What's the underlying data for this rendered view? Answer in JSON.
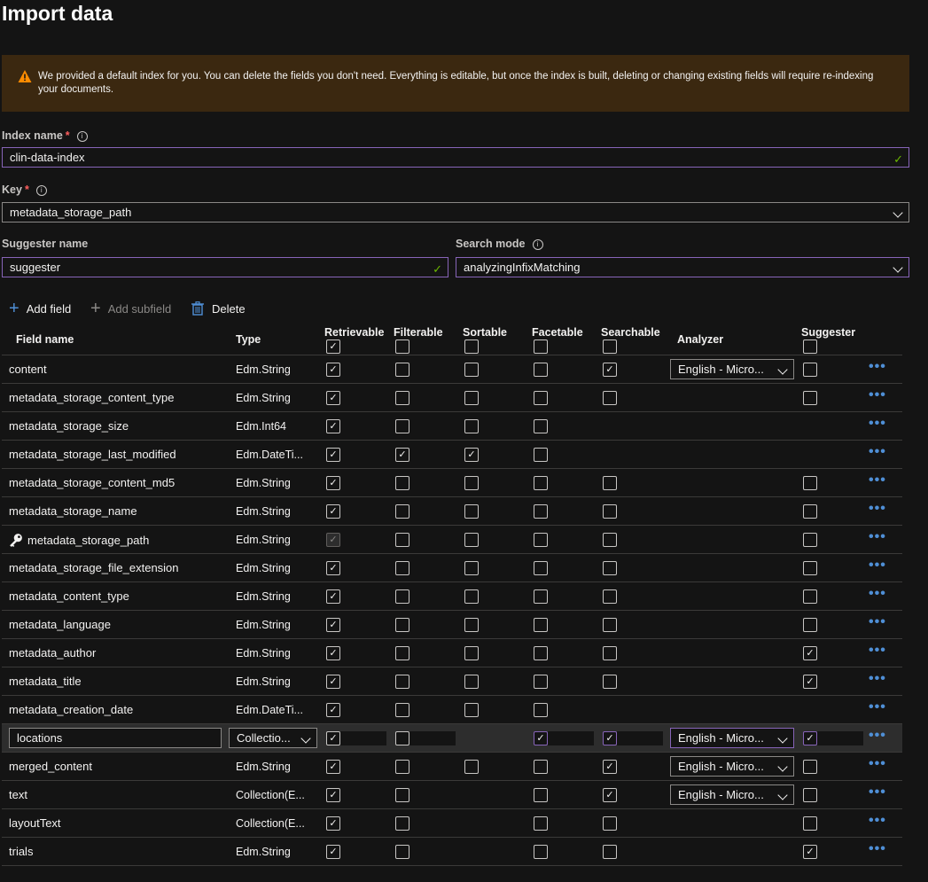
{
  "page_title": "Import data",
  "banner": {
    "message": "We provided a default index for you. You can delete the fields you don't need. Everything is editable, but once the index is built, deleting or changing existing fields will require re-indexing your documents."
  },
  "index_name": {
    "label": "Index name",
    "required_mark": "*",
    "value": "clin-data-index"
  },
  "key": {
    "label": "Key",
    "required_mark": "*",
    "value": "metadata_storage_path"
  },
  "suggester_name": {
    "label": "Suggester name",
    "value": "suggester"
  },
  "search_mode": {
    "label": "Search mode",
    "value": "analyzingInfixMatching"
  },
  "toolbar": {
    "add_field": "Add field",
    "add_subfield": "Add subfield",
    "delete": "Delete"
  },
  "columns": {
    "field_name": "Field name",
    "type": "Type",
    "retrievable": "Retrievable",
    "filterable": "Filterable",
    "sortable": "Sortable",
    "facetable": "Facetable",
    "searchable": "Searchable",
    "analyzer": "Analyzer",
    "suggester": "Suggester"
  },
  "header_checks": {
    "retrievable": true,
    "filterable": false,
    "sortable": false,
    "facetable": false,
    "searchable": false,
    "suggester": false
  },
  "fields": [
    {
      "name": "content",
      "type": "Edm.String",
      "retrievable": true,
      "filterable": false,
      "sortable": false,
      "facetable": false,
      "searchable": true,
      "analyzer": "English - Micro...",
      "suggester": false
    },
    {
      "name": "metadata_storage_content_type",
      "type": "Edm.String",
      "retrievable": true,
      "filterable": false,
      "sortable": false,
      "facetable": false,
      "searchable": false,
      "analyzer": null,
      "suggester": false
    },
    {
      "name": "metadata_storage_size",
      "type": "Edm.Int64",
      "retrievable": true,
      "filterable": false,
      "sortable": false,
      "facetable": false,
      "searchable": null,
      "analyzer": null,
      "suggester": null
    },
    {
      "name": "metadata_storage_last_modified",
      "type": "Edm.DateTi...",
      "retrievable": true,
      "filterable": true,
      "sortable": true,
      "facetable": false,
      "searchable": null,
      "analyzer": null,
      "suggester": null
    },
    {
      "name": "metadata_storage_content_md5",
      "type": "Edm.String",
      "retrievable": true,
      "filterable": false,
      "sortable": false,
      "facetable": false,
      "searchable": false,
      "analyzer": null,
      "suggester": false
    },
    {
      "name": "metadata_storage_name",
      "type": "Edm.String",
      "retrievable": true,
      "filterable": false,
      "sortable": false,
      "facetable": false,
      "searchable": false,
      "analyzer": null,
      "suggester": false
    },
    {
      "name": "metadata_storage_path",
      "type": "Edm.String",
      "retrievable": "disabled",
      "filterable": false,
      "sortable": false,
      "facetable": false,
      "searchable": false,
      "analyzer": null,
      "suggester": false,
      "is_key": true
    },
    {
      "name": "metadata_storage_file_extension",
      "type": "Edm.String",
      "retrievable": true,
      "filterable": false,
      "sortable": false,
      "facetable": false,
      "searchable": false,
      "analyzer": null,
      "suggester": false
    },
    {
      "name": "metadata_content_type",
      "type": "Edm.String",
      "retrievable": true,
      "filterable": false,
      "sortable": false,
      "facetable": false,
      "searchable": false,
      "analyzer": null,
      "suggester": false
    },
    {
      "name": "metadata_language",
      "type": "Edm.String",
      "retrievable": true,
      "filterable": false,
      "sortable": false,
      "facetable": false,
      "searchable": false,
      "analyzer": null,
      "suggester": false
    },
    {
      "name": "metadata_author",
      "type": "Edm.String",
      "retrievable": true,
      "filterable": false,
      "sortable": false,
      "facetable": false,
      "searchable": false,
      "analyzer": null,
      "suggester": true
    },
    {
      "name": "metadata_title",
      "type": "Edm.String",
      "retrievable": true,
      "filterable": false,
      "sortable": false,
      "facetable": false,
      "searchable": false,
      "analyzer": null,
      "suggester": true
    },
    {
      "name": "metadata_creation_date",
      "type": "Edm.DateTi...",
      "retrievable": true,
      "filterable": false,
      "sortable": false,
      "facetable": false,
      "searchable": null,
      "analyzer": null,
      "suggester": null
    },
    {
      "name": "locations",
      "type": "Collectio...",
      "retrievable": true,
      "filterable": false,
      "sortable": null,
      "facetable": true,
      "searchable": true,
      "analyzer": "English - Micro...",
      "suggester": true,
      "editing": true
    },
    {
      "name": "merged_content",
      "type": "Edm.String",
      "retrievable": true,
      "filterable": false,
      "sortable": false,
      "facetable": false,
      "searchable": true,
      "analyzer": "English - Micro...",
      "suggester": false
    },
    {
      "name": "text",
      "type": "Collection(E...",
      "retrievable": true,
      "filterable": false,
      "sortable": null,
      "facetable": false,
      "searchable": true,
      "analyzer": "English - Micro...",
      "suggester": false
    },
    {
      "name": "layoutText",
      "type": "Collection(E...",
      "retrievable": true,
      "filterable": false,
      "sortable": null,
      "facetable": false,
      "searchable": false,
      "analyzer": null,
      "suggester": false
    },
    {
      "name": "trials",
      "type": "Edm.String",
      "retrievable": true,
      "filterable": false,
      "sortable": null,
      "facetable": false,
      "searchable": false,
      "analyzer": null,
      "suggester": true
    }
  ],
  "more_label": "•••",
  "colors": {
    "accent_border": "#8764b8",
    "valid_check": "#6bb700",
    "link_blue": "#4f8fd6",
    "warning_bg": "#3b2810"
  }
}
